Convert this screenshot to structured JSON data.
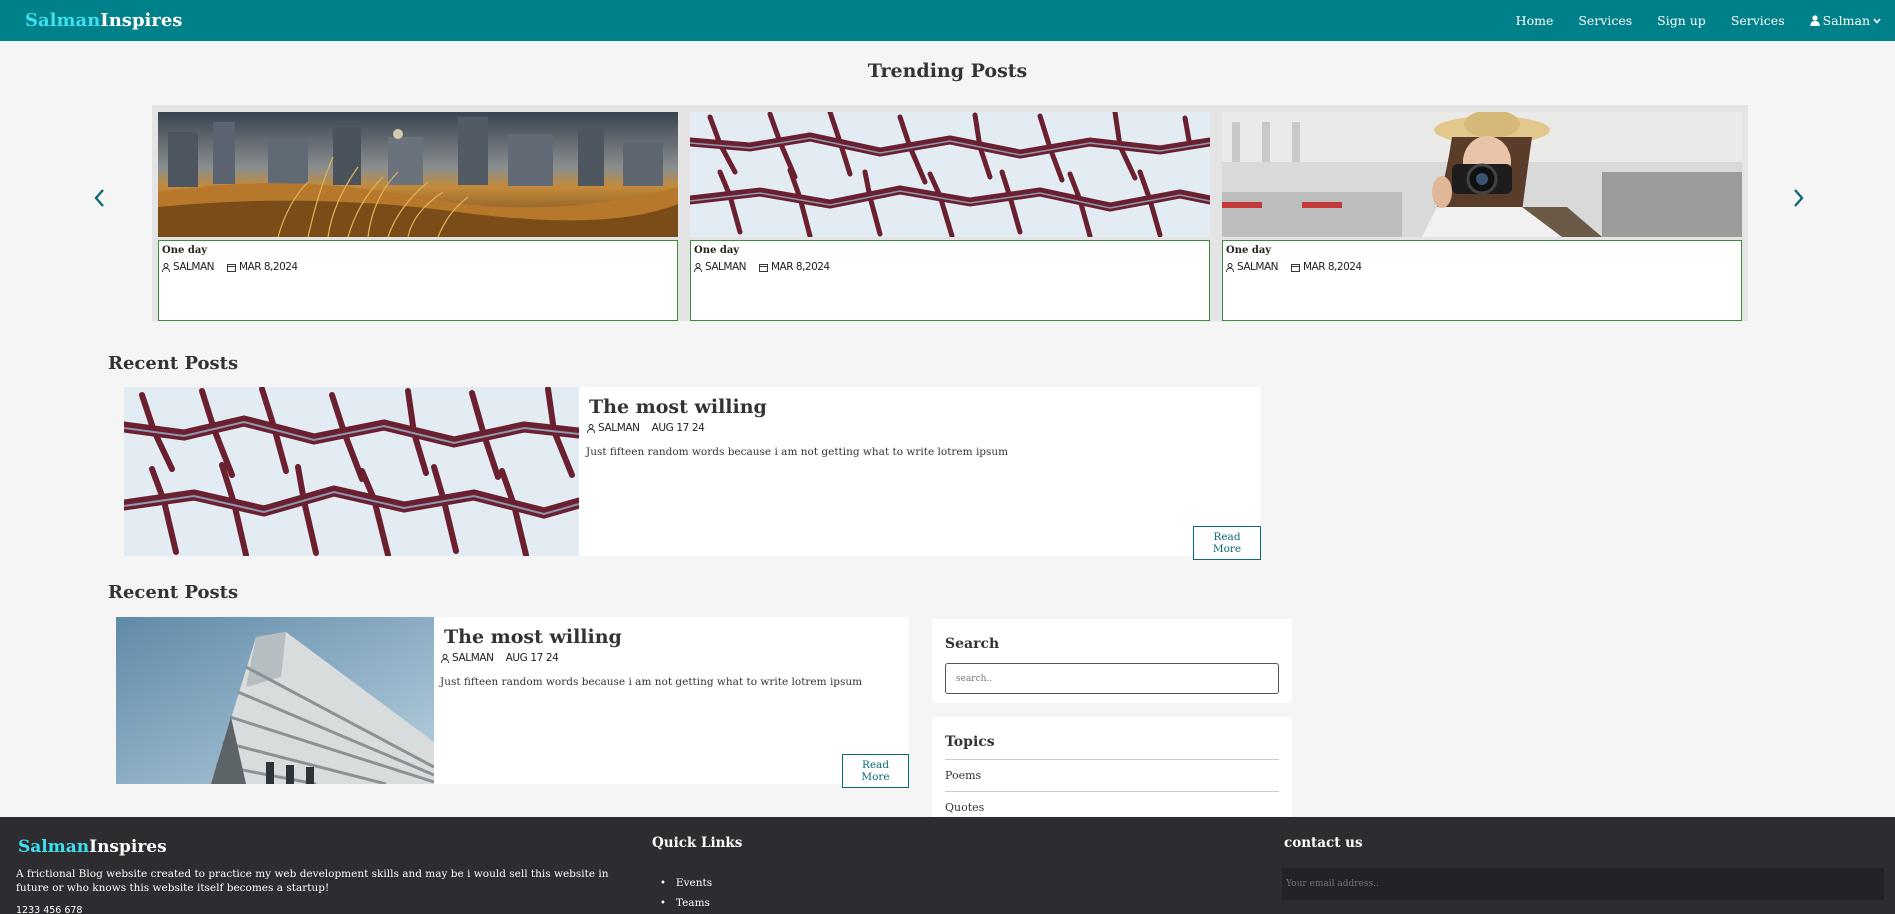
{
  "navbar": {
    "brand_first": "Salman",
    "brand_second": "Inspires",
    "links": [
      "Home",
      "Services",
      "Sign up",
      "Services"
    ],
    "user_label": "Salman"
  },
  "trending": {
    "title": "Trending Posts",
    "cards": [
      {
        "title": "One day",
        "author": "SALMAN",
        "date": "MAR 8,2024",
        "image": "city-field-photo"
      },
      {
        "title": "One day",
        "author": "SALMAN",
        "date": "MAR 8,2024",
        "image": "red-branch-pattern-photo"
      },
      {
        "title": "One day",
        "author": "SALMAN",
        "date": "MAR 8,2024",
        "image": "photographer-woman-photo"
      }
    ]
  },
  "recent1": {
    "title": "Recent Posts",
    "post": {
      "title": "The most willing",
      "author": "SALMAN",
      "date": "AUG 17 24",
      "excerpt": "Just fifteen random words because i am not getting what to write lotrem ipsum",
      "read_more": "Read More",
      "image": "red-branch-pattern-photo"
    }
  },
  "recent2": {
    "title": "Recent Posts",
    "post": {
      "title": "The most willing",
      "author": "SALMAN",
      "date": "AUG 17 24",
      "excerpt": "Just fifteen random words because i am not getting what to write lotrem ipsum",
      "read_more": "Read More",
      "image": "building-photo"
    }
  },
  "sidebar": {
    "search_title": "Search",
    "search_placeholder": "search..",
    "topics_title": "Topics",
    "topics": [
      "Poems",
      "Quotes"
    ]
  },
  "footer": {
    "brand_first": "Salman",
    "brand_second": "Inspires",
    "description": "A frictional Blog website created to practice my web development skills and may be i would sell this website in future or who knows this website itself becomes a startup!",
    "phone": "1233 456 678",
    "quick_links_title": "Quick Links",
    "quick_links": [
      "Events",
      "Teams"
    ],
    "contact_title": "contact us",
    "email_placeholder": "Your email address.."
  },
  "colors": {
    "navbar": "#008089",
    "brand_accent": "#3ee0f0",
    "card_border": "#3a8c3a",
    "footer": "#2c2c31"
  }
}
